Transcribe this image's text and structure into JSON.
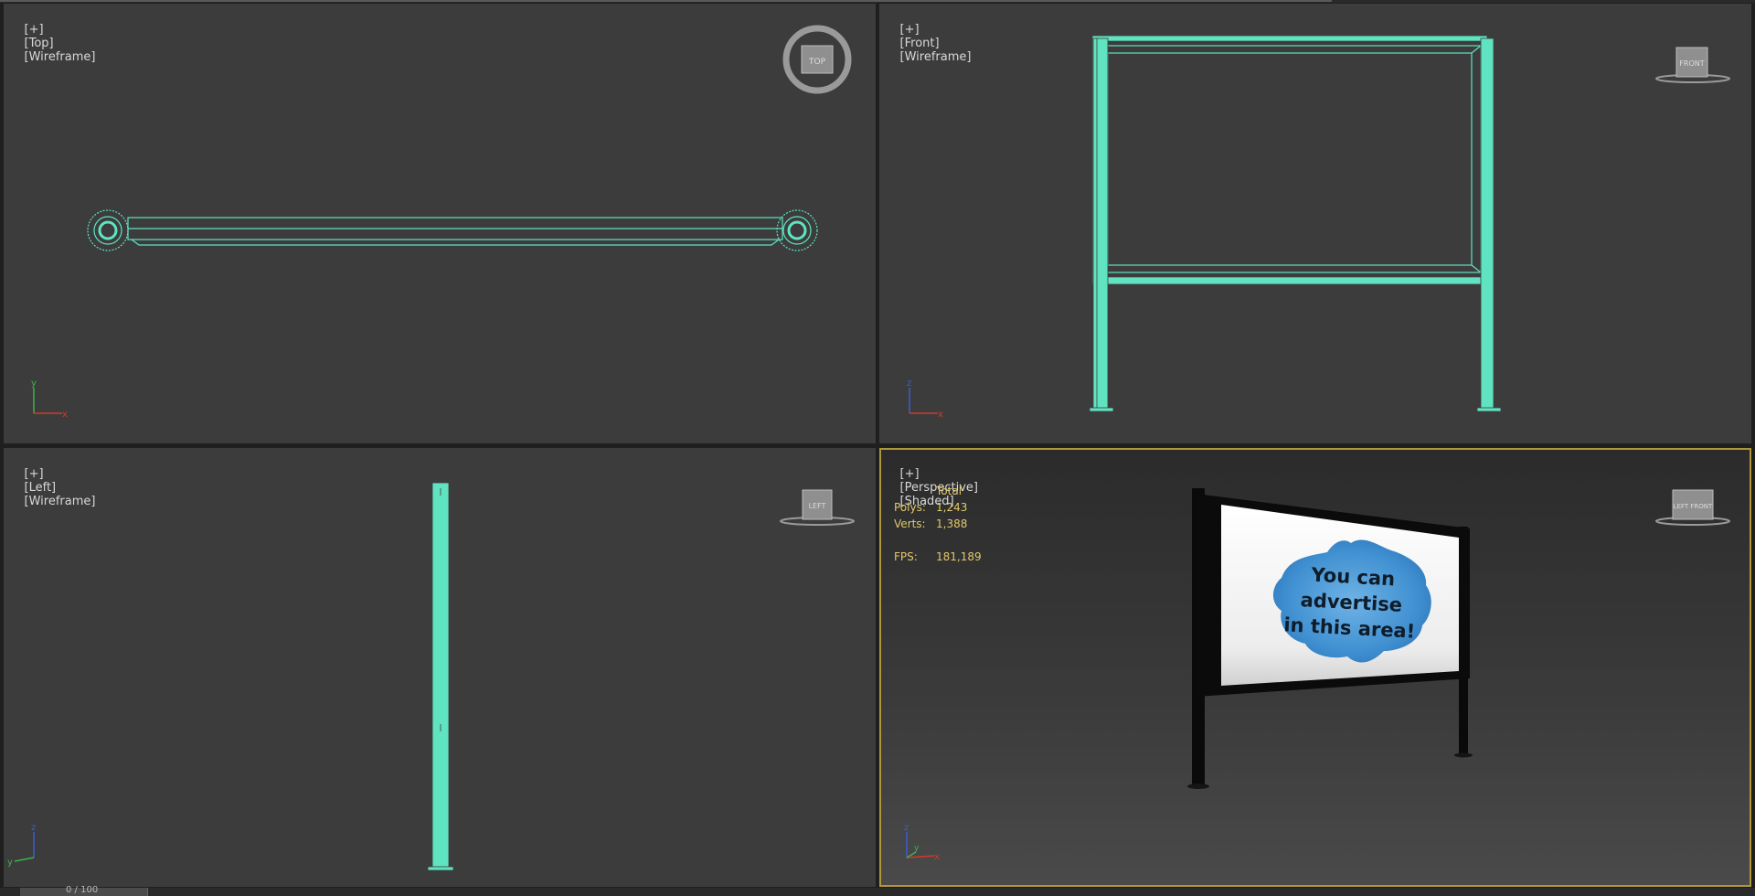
{
  "colors": {
    "viewport_bg": "#3c3c3c",
    "wireframe": "#5fe3c0",
    "active_border": "#b0963a",
    "stats_text": "#e1c96a",
    "axis_x": "#d03a2a",
    "axis_y": "#3db34a",
    "axis_z": "#3a5fd0"
  },
  "viewports": {
    "top": {
      "plus": "[+]",
      "view": "[Top]",
      "mode": "[Wireframe]",
      "viewcube_label": "TOP"
    },
    "front": {
      "plus": "[+]",
      "view": "[Front]",
      "mode": "[Wireframe]",
      "viewcube_label": "FRONT"
    },
    "left": {
      "plus": "[+]",
      "view": "[Left]",
      "mode": "[Wireframe]",
      "viewcube_label": "LEFT"
    },
    "perspective": {
      "plus": "[+]",
      "view": "[Perspective]",
      "mode": "[Shaded]",
      "viewcube_label": "LEFT FRONT"
    }
  },
  "stats": {
    "header": "Total",
    "polys_label": "Polys:",
    "polys_value": "1,243",
    "verts_label": "Verts:",
    "verts_value": "1,388",
    "fps_label": "FPS:",
    "fps_value": "181,189"
  },
  "billboard": {
    "line1": "You can",
    "line2": "advertise",
    "line3": "in this area!"
  },
  "axes": {
    "top": [
      "y",
      "x"
    ],
    "front": [
      "z",
      "x"
    ],
    "left": [
      "z",
      "y"
    ],
    "perspective": [
      "z",
      "x",
      "y"
    ]
  },
  "timeline": {
    "label": "0 / 100"
  },
  "icons": [
    "viewcube-icon",
    "axis-tripod-icon"
  ]
}
